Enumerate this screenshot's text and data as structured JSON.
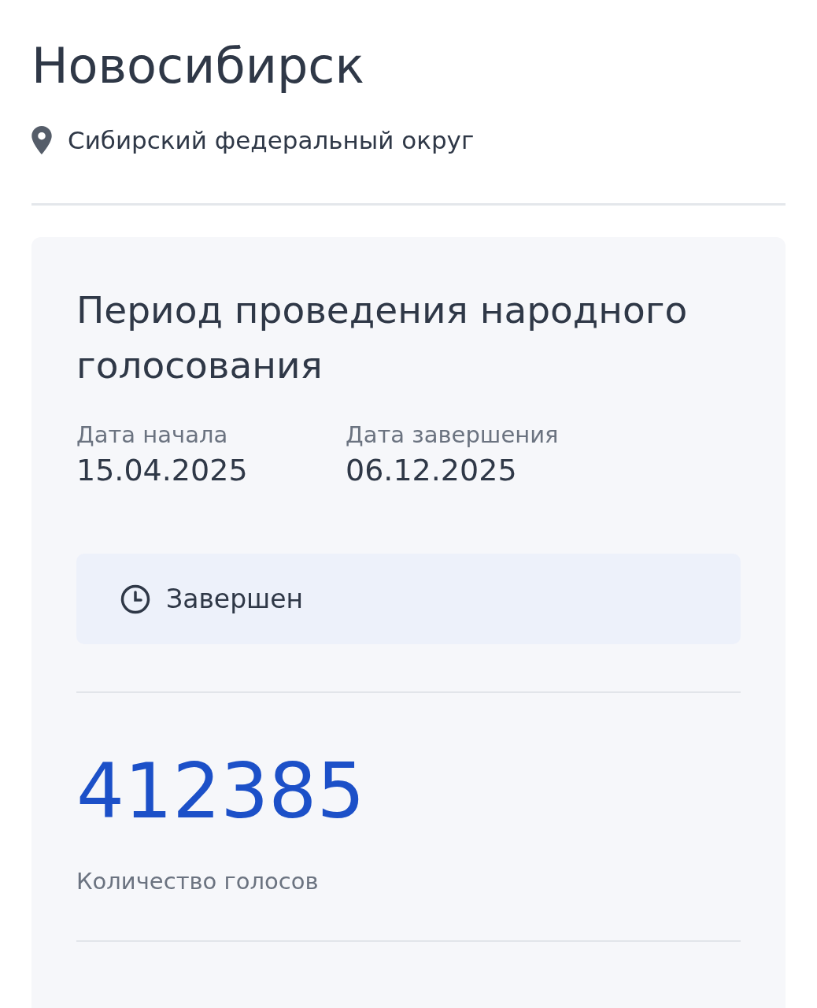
{
  "city": {
    "title": "Новосибирск",
    "district": "Сибирский федеральный округ"
  },
  "period": {
    "heading": "Период проведения народного голосования",
    "dates": [
      {
        "label": "Дата начала",
        "value": "15.04.2025"
      },
      {
        "label": "Дата завершения",
        "value": "06.12.2025"
      }
    ],
    "status": "Завершен"
  },
  "votes": {
    "count": "412385",
    "label": "Количество голосов"
  }
}
